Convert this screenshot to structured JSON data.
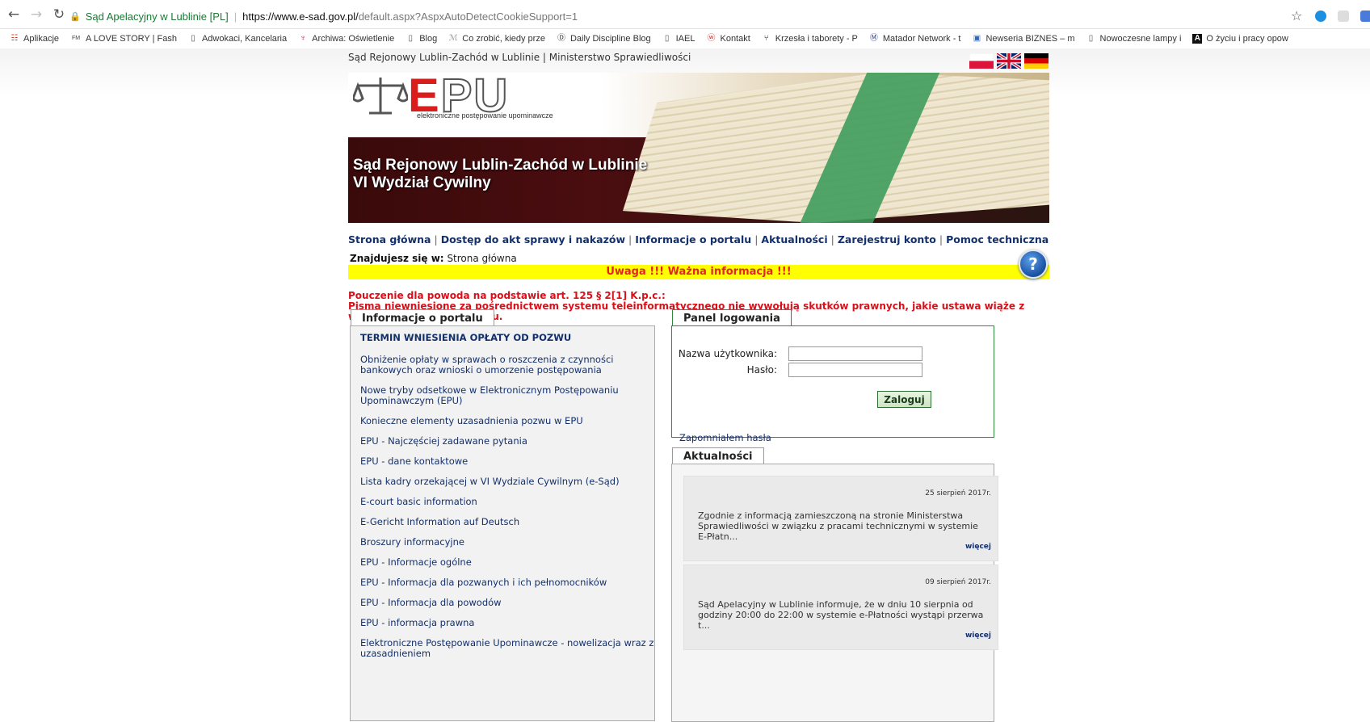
{
  "browser": {
    "tab_site": "Sąd Apelacyjny w Lublinie [PL]",
    "url_main": "https://www.e-sad.gov.pl/",
    "url_rest": "default.aspx?AspxAutoDetectCookieSupport=1",
    "bookmarks": [
      {
        "label": "Aplikacje",
        "icon": "apps-grid-icon"
      },
      {
        "label": "A LOVE STORY | Fash",
        "icon": "fm-icon"
      },
      {
        "label": "Adwokaci, Kancelaria",
        "icon": "page-icon"
      },
      {
        "label": "Archiwa: Oświetlenie",
        "icon": "lamp-icon"
      },
      {
        "label": "Blog",
        "icon": "page-icon"
      },
      {
        "label": "Co zrobić, kiedy prze",
        "icon": "script-icon"
      },
      {
        "label": "Daily Discipline Blog",
        "icon": "circle-logo-icon"
      },
      {
        "label": "IAEL",
        "icon": "page-icon"
      },
      {
        "label": "Kontakt",
        "icon": "w-logo-icon"
      },
      {
        "label": "Krzesła i taborety - P",
        "icon": "chair-icon"
      },
      {
        "label": "Matador Network - t",
        "icon": "m-logo-icon"
      },
      {
        "label": "Newseria BIZNES – m",
        "icon": "newseria-icon"
      },
      {
        "label": "Nowoczesne lampy i",
        "icon": "page-icon"
      },
      {
        "label": "O życiu i pracy opow",
        "icon": "a-logo-icon"
      }
    ]
  },
  "header": {
    "top_line": "Sąd Rejonowy Lublin-Zachód w Lublinie | Ministerstwo Sprawiedliwości",
    "logo_e": "E",
    "logo_pu": "PU",
    "logo_sub": "elektroniczne postępowanie upominawcze",
    "banner_line1": "Sąd Rejonowy Lublin-Zachód w Lublinie",
    "banner_line2": "VI Wydział Cywilny"
  },
  "nav": {
    "items": [
      "Strona główna",
      "Dostęp do akt sprawy i nakazów",
      "Informacje o portalu",
      "Aktualności",
      "Zarejestruj konto",
      "Pomoc techniczna"
    ]
  },
  "breadcrumb": {
    "label": "Znajdujesz się w:",
    "value": "Strona główna"
  },
  "alert": "Uwaga !!! Ważna informacja !!!",
  "notice": {
    "line1": "Pouczenie dla powoda na podstawie art. 125 § 2[1] K.p.c.:",
    "line2": "Pisma niewniesione za pośrednictwem systemu teleinformatycznego nie wywołują skutków prawnych, jakie ustawa wiąże z wniesieniem pisma do sądu."
  },
  "info_panel": {
    "title": "Informacje o portalu",
    "items": [
      "TERMIN WNIESIENIA OPŁATY OD POZWU",
      "Obniżenie opłaty w sprawach o roszczenia z czynności bankowych oraz wnioski o umorzenie postępowania",
      "Nowe tryby odsetkowe w Elektronicznym Postępowaniu Upominawczym (EPU)",
      "Konieczne elementy uzasadnienia pozwu w EPU",
      "EPU - Najczęściej zadawane pytania",
      "EPU - dane kontaktowe",
      "Lista kadry orzekającej w VI Wydziale Cywilnym (e-Sąd)",
      "E-court basic information",
      "E-Gericht Information auf Deutsch",
      "Broszury informacyjne",
      "EPU - Informacje ogólne",
      "EPU - Informacja dla pozwanych i ich pełnomocników",
      "EPU - Informacja dla powodów",
      "EPU - informacja prawna",
      "Elektroniczne Postępowanie Upominawcze - nowelizacja wraz z uzasadnieniem"
    ]
  },
  "login_panel": {
    "title": "Panel logowania",
    "username_label": "Nazwa użytkownika:",
    "username_value": "",
    "password_label": "Hasło:",
    "password_value": "",
    "submit": "Zaloguj",
    "forgot": "Zapomniałem hasła"
  },
  "news_panel": {
    "title": "Aktualności",
    "items": [
      {
        "date": "25 sierpień 2017r.",
        "text": "Zgodnie z informacją zamieszczoną na stronie Ministerstwa Sprawiedliwości w związku z pracami technicznymi w systemie E-Płatn...",
        "more": "więcej"
      },
      {
        "date": "09 sierpień 2017r.",
        "text": "Sąd Apelacyjny w Lublinie informuje, że w dniu 10 sierpnia od godziny 20:00 do 22:00 w systemie e-Płatności wystąpi przerwa t...",
        "more": "więcej"
      }
    ]
  },
  "colors": {
    "nav_link": "#13306b",
    "alert_bg": "#ffff00",
    "alert_text": "#e3242b",
    "notice_text": "#d9101a",
    "login_border": "#2f8a3e",
    "logo_red": "#d91c1c"
  }
}
